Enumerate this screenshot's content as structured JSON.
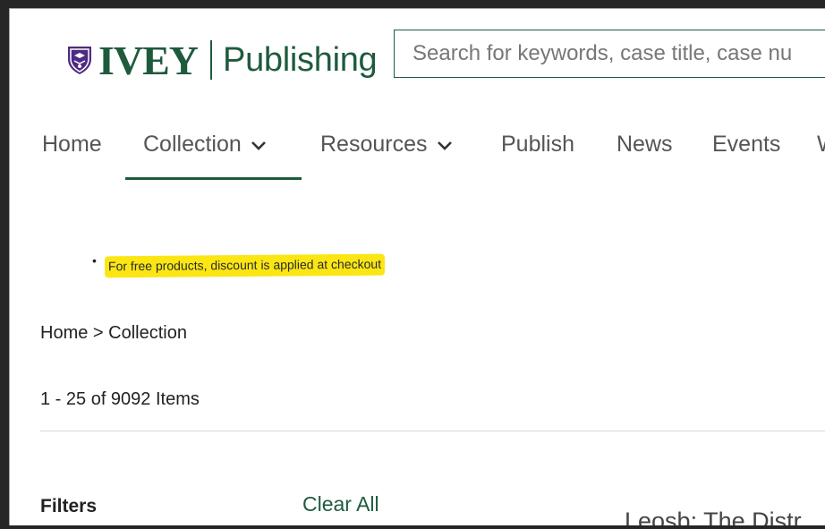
{
  "header": {
    "logo_brand": "IVEY",
    "logo_product": "Publishing",
    "search_placeholder": "Search for keywords, case title, case nu"
  },
  "nav": {
    "items": [
      {
        "label": "Home",
        "dropdown": false
      },
      {
        "label": "Collection",
        "dropdown": true,
        "active": true
      },
      {
        "label": "Resources",
        "dropdown": true
      },
      {
        "label": "Publish",
        "dropdown": false
      },
      {
        "label": "News",
        "dropdown": false
      },
      {
        "label": "Events",
        "dropdown": false
      },
      {
        "label": "W",
        "dropdown": false
      }
    ]
  },
  "notice": {
    "text": "For free products, discount is applied at checkout",
    "highlight_color": "#fbe614"
  },
  "breadcrumb": {
    "items": [
      "Home",
      "Collection"
    ],
    "separator": ">"
  },
  "results": {
    "count_text": "1 - 25 of 9092 Items"
  },
  "filters": {
    "heading": "Filters",
    "clear_label": "Clear All"
  },
  "product": {
    "title_partial": "Leosb: The Distr"
  },
  "colors": {
    "brand_green": "#1e5b3d",
    "crest_purple": "#4e2a84"
  }
}
